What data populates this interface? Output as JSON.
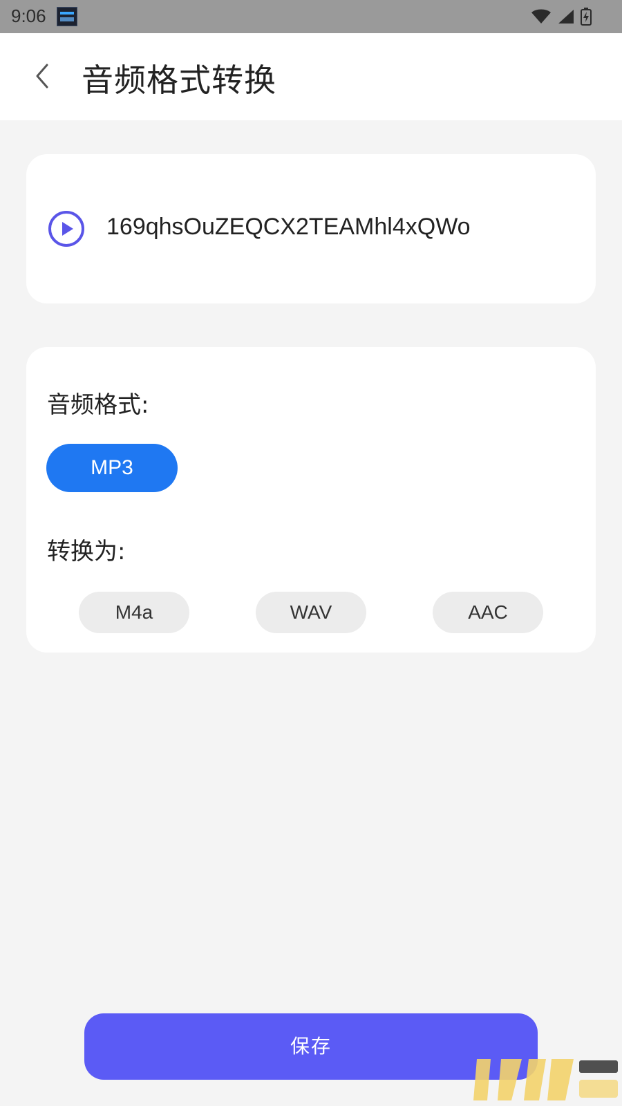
{
  "status_bar": {
    "time": "9:06",
    "icons": [
      "app-notification-icon",
      "wifi-icon",
      "cell-signal-icon",
      "battery-charging-icon"
    ]
  },
  "header": {
    "title": "音频格式转换",
    "back_icon": "chevron-left-icon"
  },
  "file": {
    "icon": "play-circle-icon",
    "name": "169qhsOuZEQCX2TEAMhl4xQWo"
  },
  "format": {
    "label": "音频格式:",
    "selected": "MP3",
    "convert_label": "转换为:",
    "options": [
      "M4a",
      "WAV",
      "AAC"
    ]
  },
  "actions": {
    "save_label": "保存"
  },
  "colors": {
    "accent_blue": "#1f78f2",
    "save_purple": "#5b5bf5",
    "play_icon": "#5a55e8",
    "background": "#f4f4f4",
    "status_bar": "#9a9a9a"
  }
}
